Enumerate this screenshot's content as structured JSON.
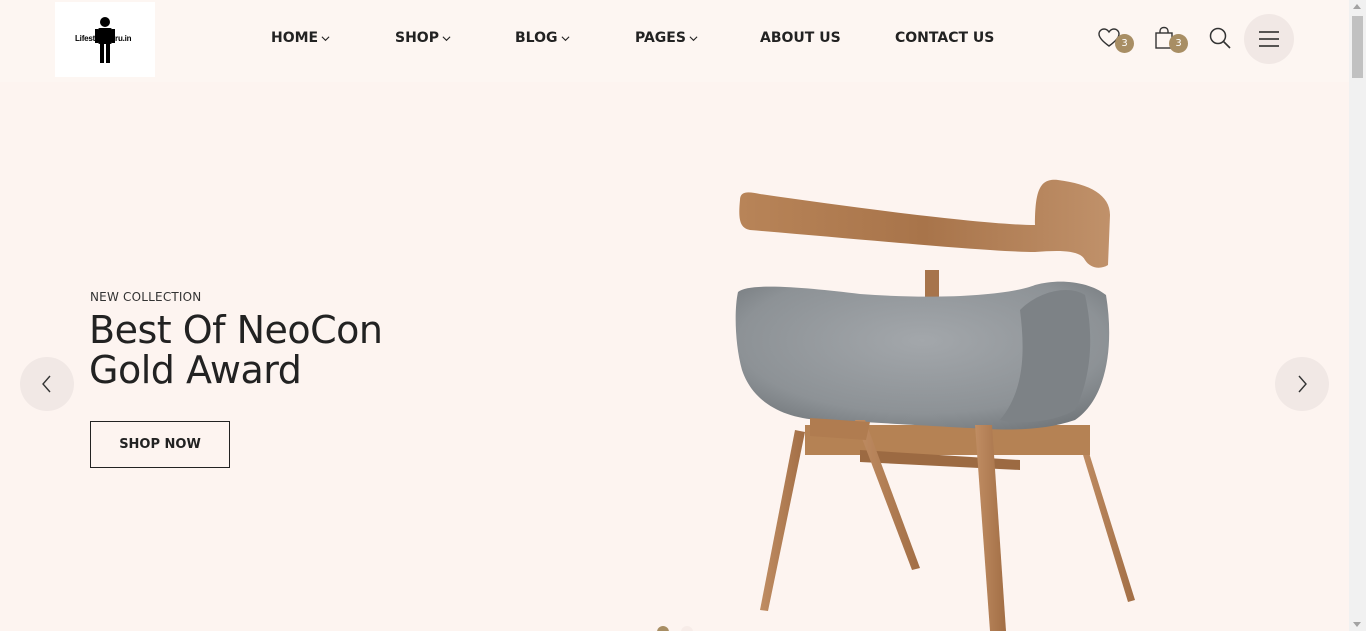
{
  "logo": {
    "text": "Lifestyleguru.in"
  },
  "nav": [
    {
      "label": "HOME",
      "dropdown": true
    },
    {
      "label": "SHOP",
      "dropdown": true
    },
    {
      "label": "BLOG",
      "dropdown": true
    },
    {
      "label": "PAGES",
      "dropdown": true
    },
    {
      "label": "ABOUT US",
      "dropdown": false
    },
    {
      "label": "CONTACT US",
      "dropdown": false
    }
  ],
  "header_icons": {
    "wishlist_count": "3",
    "cart_count": "3"
  },
  "hero": {
    "subtitle": "NEW COLLECTION",
    "title": "Best Of NeoCon Gold Award",
    "button": "SHOP NOW"
  },
  "colors": {
    "background": "#fdf4f0",
    "badge": "#a88e64",
    "circle_button": "#f1e8e5"
  }
}
